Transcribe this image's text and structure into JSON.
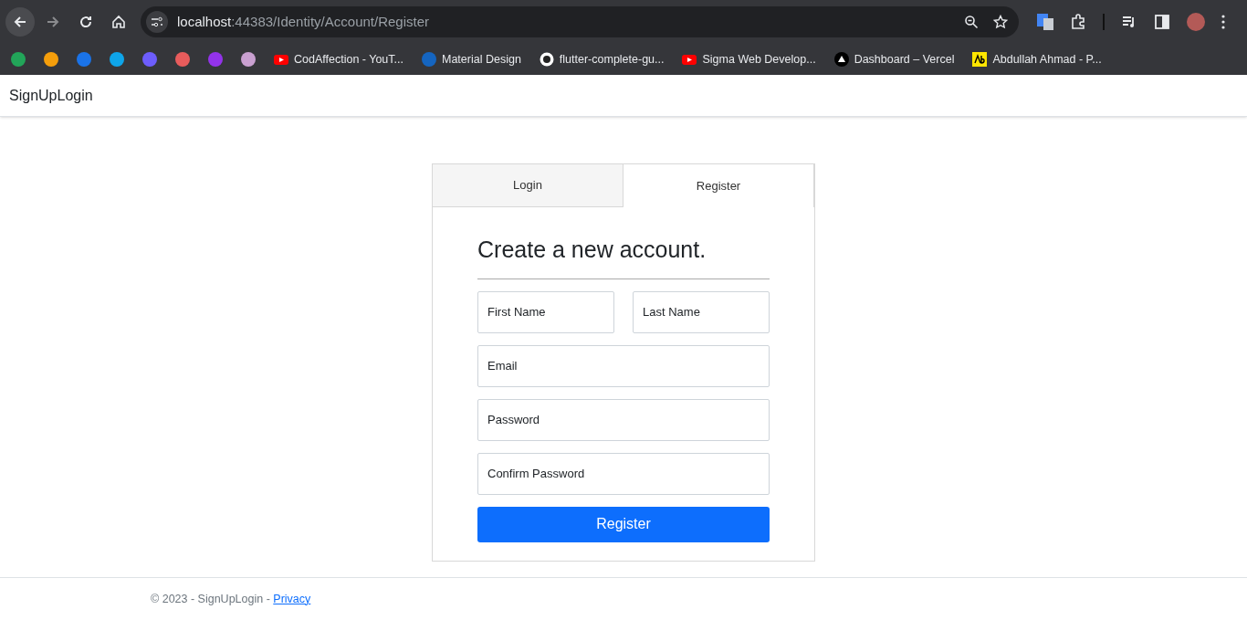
{
  "browser": {
    "url_host": "localhost",
    "url_path": ":44383/Identity/Account/Register",
    "bookmarks": [
      {
        "kind": "icon"
      },
      {
        "kind": "icon"
      },
      {
        "kind": "icon"
      },
      {
        "kind": "icon"
      },
      {
        "kind": "icon"
      },
      {
        "kind": "icon"
      },
      {
        "kind": "icon"
      },
      {
        "kind": "icon"
      },
      {
        "kind": "labeled",
        "label": "CodAffection - YouT..."
      },
      {
        "kind": "labeled",
        "label": "Material Design"
      },
      {
        "kind": "labeled",
        "label": "flutter-complete-gu..."
      },
      {
        "kind": "labeled",
        "label": "Sigma Web Develop..."
      },
      {
        "kind": "labeled",
        "label": "Dashboard – Vercel"
      },
      {
        "kind": "labeled",
        "label": "Abdullah Ahmad - P..."
      }
    ]
  },
  "navbar": {
    "brand": "SignUpLogin"
  },
  "tabs": [
    {
      "label": "Login",
      "selected": false
    },
    {
      "label": "Register",
      "selected": true
    }
  ],
  "form": {
    "title": "Create a new account.",
    "fields": [
      {
        "kind": "half",
        "placeholder": "First Name"
      },
      {
        "kind": "half",
        "placeholder": "Last Name"
      },
      {
        "kind": "full",
        "placeholder": "Email"
      },
      {
        "kind": "full",
        "placeholder": "Password"
      },
      {
        "kind": "full",
        "placeholder": "Confirm Password"
      }
    ],
    "submit": "Register"
  },
  "footer": {
    "text": "© 2023 - SignUpLogin - ",
    "link": "Privacy"
  }
}
